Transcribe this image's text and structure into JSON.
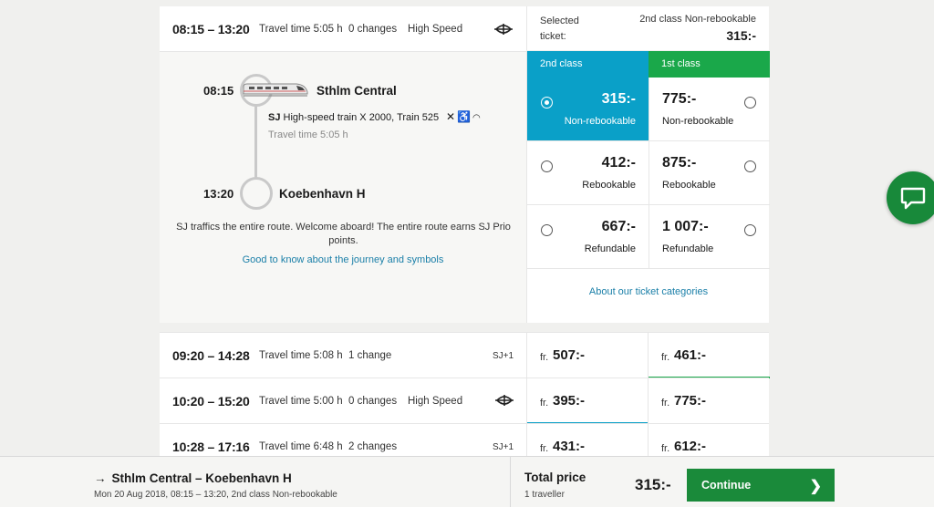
{
  "selected_journey": {
    "time": "08:15 – 13:20",
    "travel_time": "Travel time 5:05 h",
    "changes": "0 changes",
    "train_type": "High Speed",
    "operator_icon": "sj-logo-icon"
  },
  "selected_ticket": {
    "label": "Selected ticket:",
    "class_label": "2nd class Non-rebookable",
    "price": "315:-"
  },
  "details": {
    "departure": {
      "time": "08:15",
      "station": "Sthlm Central"
    },
    "arrival": {
      "time": "13:20",
      "station": "Koebenhavn H"
    },
    "train_operator": "SJ",
    "train_name": "High-speed train X 2000, Train 525",
    "travel_time": "Travel time 5:05 h",
    "amenities": [
      "no-food-icon",
      "wheelchair-icon",
      "wifi-icon"
    ],
    "welcome_text": "SJ traffics the entire route. Welcome aboard! The entire route earns SJ Prio points.",
    "good_to_know_link": "Good to know about the journey and symbols"
  },
  "fares": {
    "class_headers": [
      {
        "label": "2nd class",
        "color": "#0aa0c8"
      },
      {
        "label": "1st class",
        "color": "#1aa84a"
      }
    ],
    "rows": [
      {
        "second": {
          "price": "315:-",
          "type": "Non-rebookable",
          "selected": true
        },
        "first": {
          "price": "775:-",
          "type": "Non-rebookable",
          "selected": false
        }
      },
      {
        "second": {
          "price": "412:-",
          "type": "Rebookable",
          "selected": false
        },
        "first": {
          "price": "875:-",
          "type": "Rebookable",
          "selected": false
        }
      },
      {
        "second": {
          "price": "667:-",
          "type": "Refundable",
          "selected": false
        },
        "first": {
          "price": "1 007:-",
          "type": "Refundable",
          "selected": false
        }
      }
    ],
    "categories_link": "About our ticket categories"
  },
  "journeys": [
    {
      "time": "09:20 – 14:28",
      "travel_time": "Travel time 5:08 h",
      "changes": "1 change",
      "train_type": "",
      "operator": "SJ+1",
      "from_label": "fr.",
      "second_price": "507:-",
      "first_price": "461:-"
    },
    {
      "time": "10:20 – 15:20",
      "travel_time": "Travel time 5:00 h",
      "changes": "0 changes",
      "train_type": "High Speed",
      "operator": "",
      "from_label": "fr.",
      "second_price": "395:-",
      "first_price": "775:-"
    },
    {
      "time": "10:28 – 17:16",
      "travel_time": "Travel time 6:48 h",
      "changes": "2 changes",
      "train_type": "",
      "operator": "SJ+1",
      "from_label": "fr.",
      "second_price": "431:-",
      "first_price": "612:-"
    }
  ],
  "bottom_bar": {
    "route_arrow": "→",
    "route": "Sthlm Central – Koebenhavn H",
    "meta": "Mon 20 Aug 2018, 08:15 – 13:20, 2nd class Non-rebookable",
    "total_label": "Total price",
    "travellers": "1 traveller",
    "total_price": "315:-",
    "continue_label": "Continue",
    "continue_icon": "chevron-right-icon"
  },
  "colors": {
    "second_class": "#0aa0c8",
    "first_class": "#1aa84a",
    "continue": "#1a8a3a",
    "link": "#1a7fa8"
  }
}
